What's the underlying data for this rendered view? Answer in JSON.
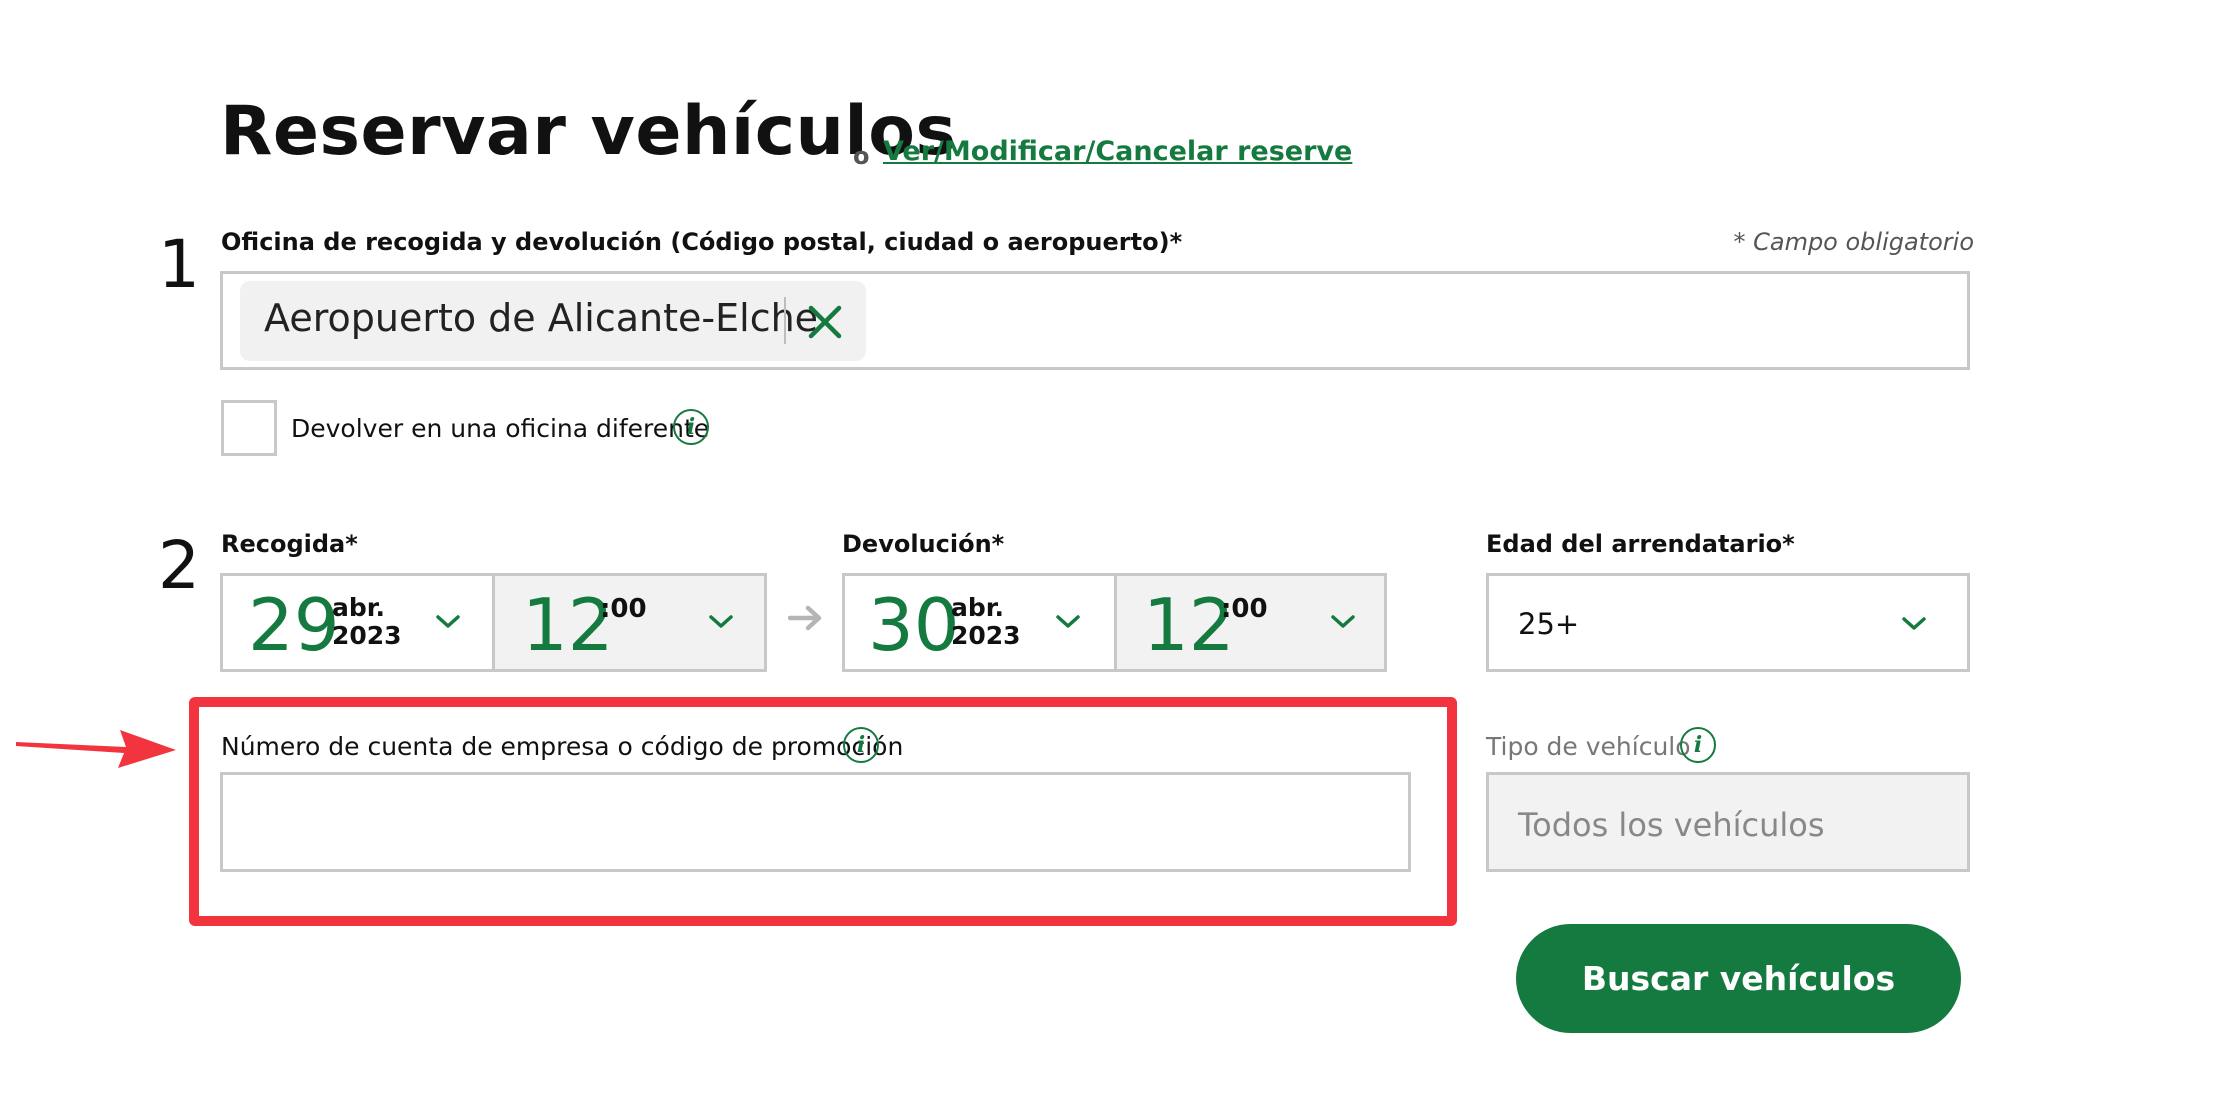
{
  "header": {
    "title": "Reservar vehículos",
    "separator": "o",
    "modify_link": "Ver/Modificar/Cancelar reserve"
  },
  "step1": {
    "number": "1",
    "label": "Oficina de recogida y devolución (Código postal, ciudad o aeropuerto)*",
    "required_note": "* Campo obligatorio",
    "selected_location": "Aeropuerto de Alicante-Elche",
    "return_different_label": "Devolver en una oficina diferente",
    "return_different_checked": false
  },
  "step2": {
    "number": "2",
    "pickup": {
      "label": "Recogida*",
      "day": "29",
      "month": "abr.",
      "year": "2023",
      "hour": "12",
      "minutes": ":00"
    },
    "return": {
      "label": "Devolución*",
      "day": "30",
      "month": "abr.",
      "year": "2023",
      "hour": "12",
      "minutes": ":00"
    },
    "age": {
      "label": "Edad del arrendatario*",
      "value": "25+"
    },
    "promo": {
      "label": "Número de cuenta de empresa o código de promoción",
      "value": ""
    },
    "vehicle_type": {
      "label": "Tipo de vehículo",
      "value": "Todos los vehículos"
    },
    "search_button": "Buscar vehículos"
  },
  "colors": {
    "brand_green": "#157a3f",
    "highlight_red": "#f2343f",
    "border_gray": "#c8c8c8"
  },
  "icons": [
    "info-icon",
    "close-icon",
    "chevron-down-icon",
    "arrow-right-icon",
    "annotation-arrow-icon"
  ]
}
